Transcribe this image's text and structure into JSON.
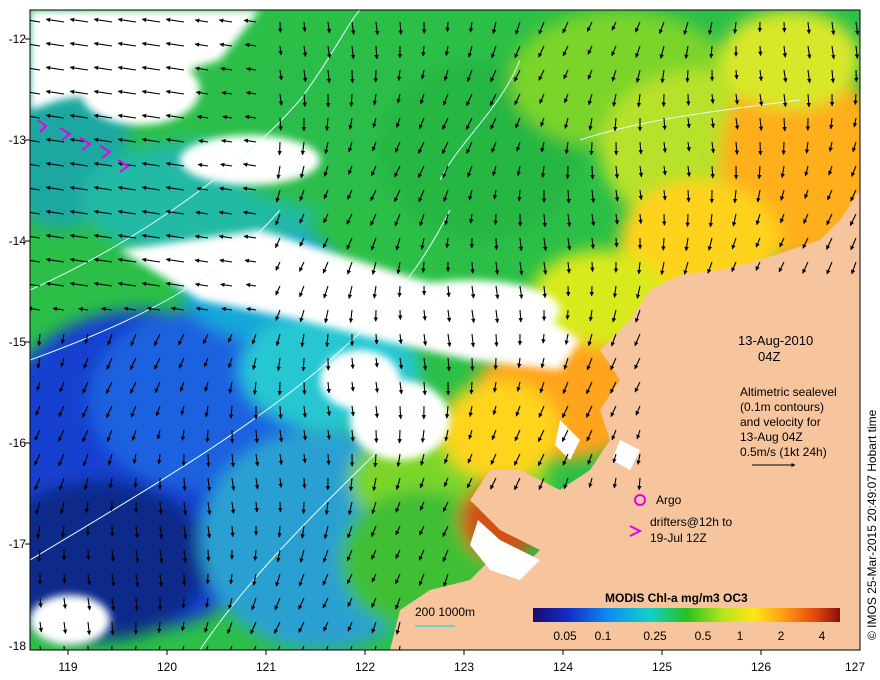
{
  "map": {
    "lon_ticks": [
      "119",
      "120",
      "121",
      "122",
      "123",
      "124",
      "125",
      "126",
      "127"
    ],
    "lat_ticks": [
      "-12",
      "-13",
      "-14",
      "-15",
      "-16",
      "-17",
      "-18"
    ],
    "date_line1": "13-Aug-2010",
    "date_line2": "04Z",
    "info_lines": [
      "Altimetric sealevel",
      "(0.1m contours)",
      "and velocity for",
      "13-Aug 04Z",
      "0.5m/s (1kt 24h)"
    ],
    "argo_label": "Argo",
    "drifters_line1": "drifters@12h to",
    "drifters_line2": "19-Jul 12Z",
    "bathy_label": "200  1000m",
    "colorbar_title": "MODIS Chl-a mg/m3 OC3",
    "colorbar_ticks": [
      "0.05",
      "0.1",
      "0.25",
      "0.5",
      "1",
      "2",
      "4"
    ],
    "credit": "© IMOS 25-Mar-2015 20:49:07 Hobart time"
  },
  "colors": {
    "land": "#f6c59d",
    "deep_blue": "#0b2a8a",
    "cloud": "#ffffff",
    "drifter": "#e600e6",
    "contour": "#dfffff",
    "bathy": "#3bd6d6"
  }
}
